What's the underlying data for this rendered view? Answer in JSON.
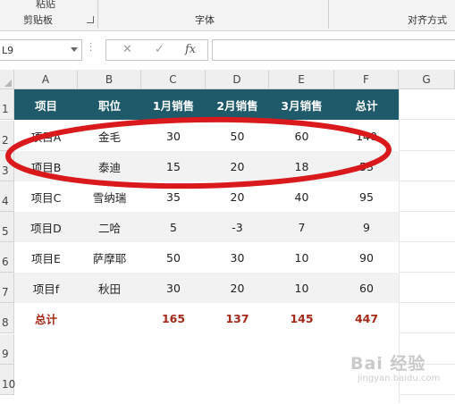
{
  "ribbon": {
    "top_cut_label": "粘贴",
    "groups": [
      "剪贴板",
      "字体",
      "对齐方式"
    ]
  },
  "formula_bar": {
    "name_box": "L9",
    "cancel_icon": "✕",
    "enter_icon": "✓",
    "fx_label": "fx",
    "formula": ""
  },
  "columns": [
    "A",
    "B",
    "C",
    "D",
    "E",
    "F",
    "G"
  ],
  "rows": [
    "1",
    "2",
    "3",
    "4",
    "5",
    "6",
    "7",
    "8",
    "9",
    "10"
  ],
  "table": {
    "headers": [
      "项目",
      "职位",
      "1月销售",
      "2月销售",
      "3月销售",
      "总计"
    ],
    "body": [
      [
        "项目A",
        "金毛",
        "30",
        "50",
        "60",
        "140"
      ],
      [
        "项目B",
        "泰迪",
        "15",
        "20",
        "18",
        "53"
      ],
      [
        "项目C",
        "雪纳瑞",
        "35",
        "20",
        "40",
        "95"
      ],
      [
        "项目D",
        "二哈",
        "5",
        "-3",
        "7",
        "9"
      ],
      [
        "项目E",
        "萨摩耶",
        "50",
        "30",
        "10",
        "90"
      ],
      [
        "项目f",
        "秋田",
        "30",
        "20",
        "10",
        "60"
      ]
    ],
    "totals": [
      "总计",
      "",
      "165",
      "137",
      "145",
      "447"
    ]
  },
  "colors": {
    "header_bg": "#1f5a6b",
    "total_text": "#a52a1a",
    "annotation": "#d9191c"
  },
  "watermark": {
    "main": "Bai 经验",
    "sub": "jingyan.baidu.com"
  }
}
